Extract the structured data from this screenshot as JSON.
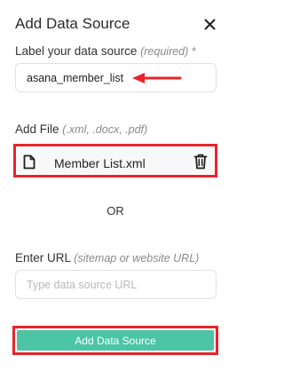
{
  "dialog": {
    "title": "Add Data Source",
    "close_icon": "close-icon"
  },
  "label_field": {
    "label": "Label your data source",
    "hint": "(required)",
    "required_mark": "*",
    "value": "asana_member_list"
  },
  "file_field": {
    "label": "Add File",
    "hint": "(.xml, .docx, .pdf)",
    "file_name": "Member List.xml",
    "file_icon": "file-icon",
    "delete_icon": "trash-icon"
  },
  "separator": "OR",
  "url_field": {
    "label": "Enter URL",
    "hint": "(sitemap or website URL)",
    "placeholder": "Type data source URL",
    "value": ""
  },
  "submit_label": "Add Data Source",
  "colors": {
    "primary": "#4cc5a6",
    "highlight": "#e8242c"
  }
}
